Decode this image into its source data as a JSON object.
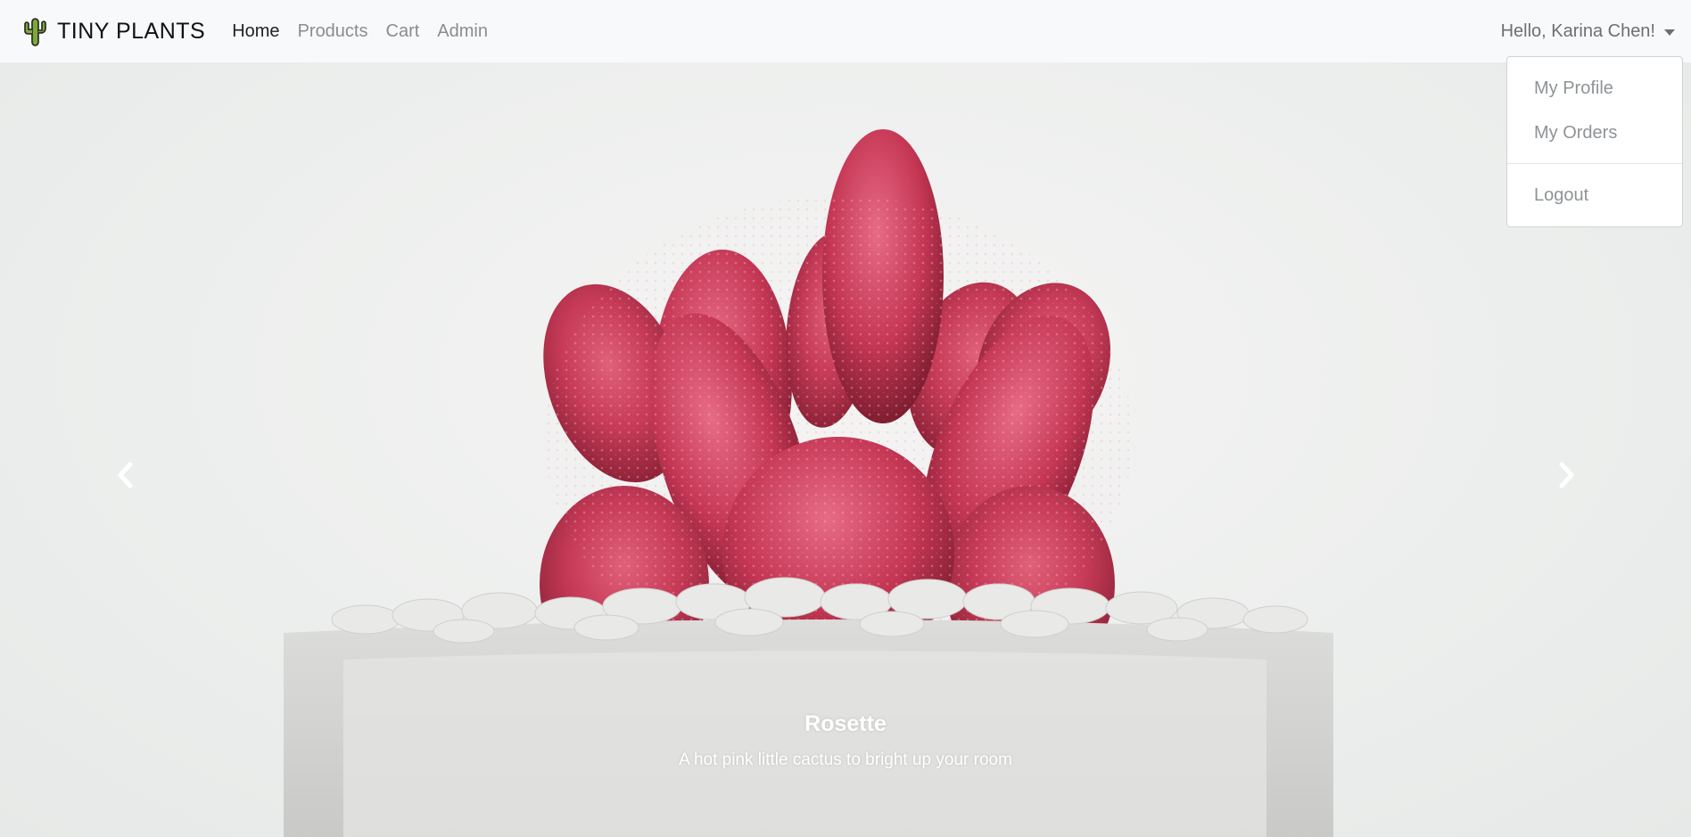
{
  "brand": {
    "name": "TINY PLANTS",
    "logo_icon": "cactus-icon"
  },
  "nav": {
    "items": [
      {
        "label": "Home",
        "active": true
      },
      {
        "label": "Products",
        "active": false
      },
      {
        "label": "Cart",
        "active": false
      },
      {
        "label": "Admin",
        "active": false
      }
    ]
  },
  "user_menu": {
    "greeting": "Hello, Karina Chen!",
    "items": [
      {
        "label": "My Profile"
      },
      {
        "label": "My Orders"
      },
      {
        "label": "Logout"
      }
    ]
  },
  "carousel": {
    "slide": {
      "title": "Rosette",
      "text": "A hot pink little cactus to bright up your room"
    },
    "prev_icon": "chevron-left-icon",
    "next_icon": "chevron-right-icon"
  },
  "colors": {
    "navbar_bg": "#f8f9fa",
    "cactus_pink": "#c83a57",
    "muted_text": "#8a8d90"
  }
}
